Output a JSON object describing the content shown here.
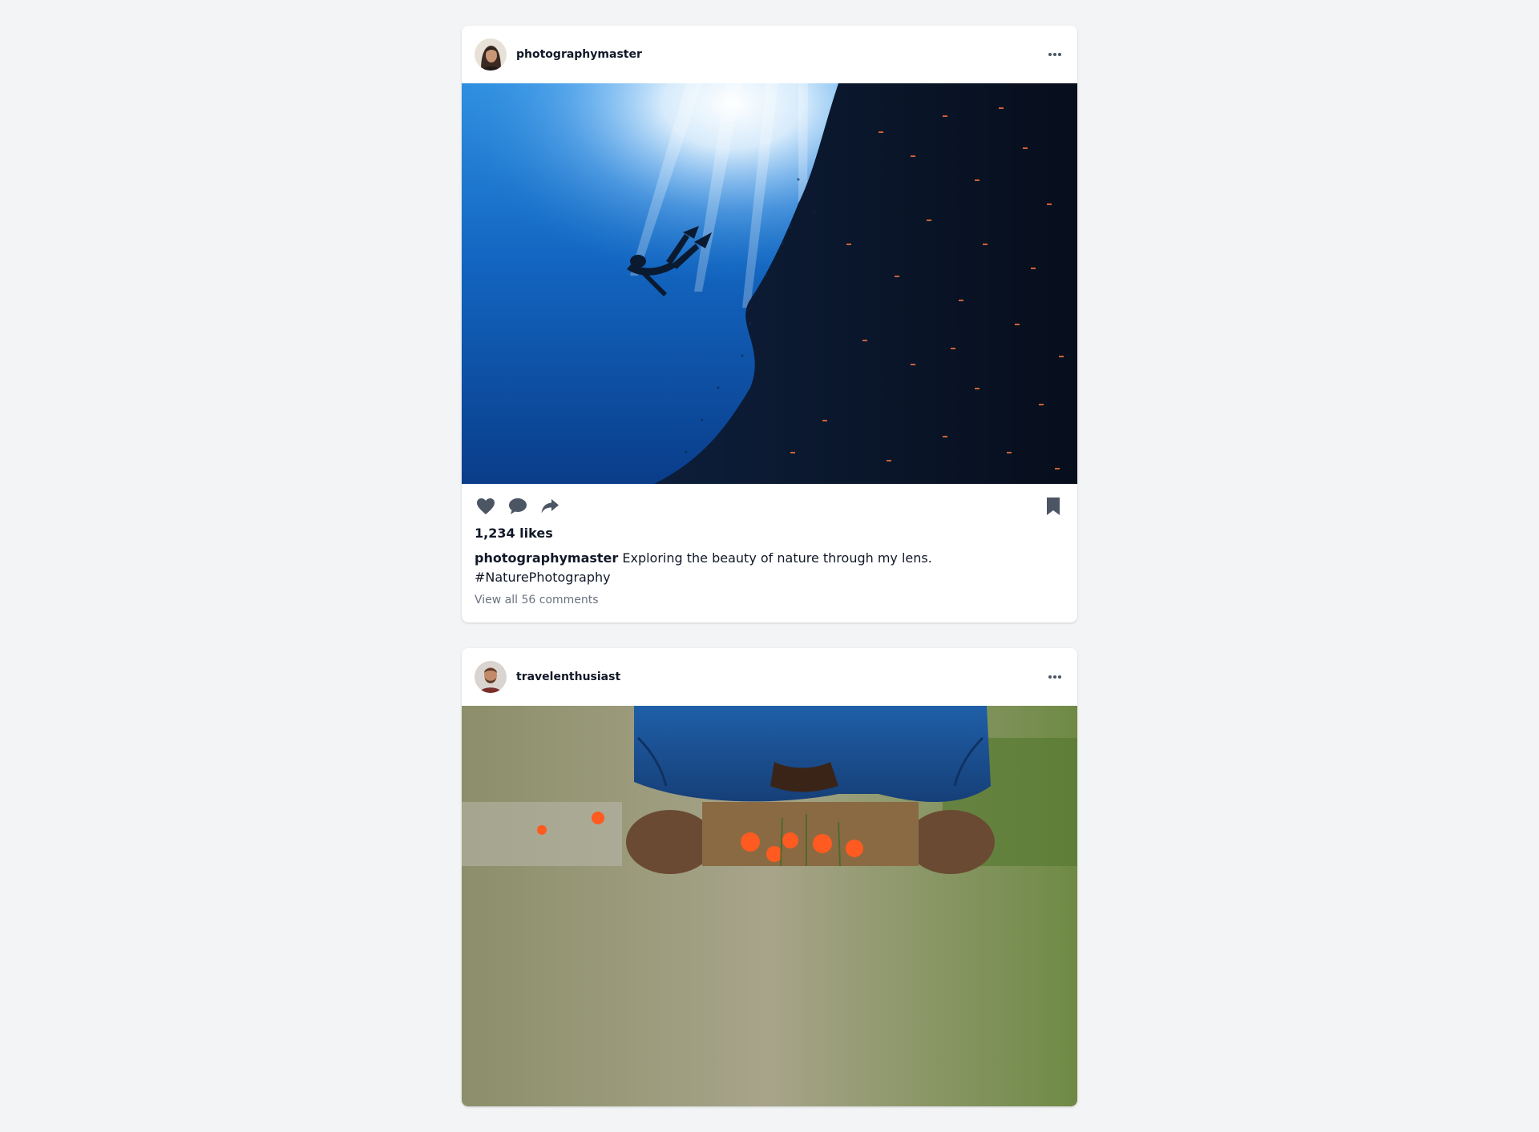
{
  "colors": {
    "background": "#f3f4f6",
    "card": "#ffffff",
    "icon": "#4b5563",
    "muted_text": "#6b7280"
  },
  "posts": [
    {
      "username": "photographymaster",
      "avatar_icon": "avatar-woman-icon",
      "image_description_icon": "underwater-diver-with-fish-school",
      "likes": "1,234 likes",
      "caption_user": "photographymaster",
      "caption_text": "Exploring the beauty of nature through my lens. #NaturePhotography",
      "comments": "View all 56 comments"
    },
    {
      "username": "travelenthusiast",
      "avatar_icon": "avatar-man-icon",
      "image_description_icon": "person-crouching-with-poppies"
    }
  ]
}
